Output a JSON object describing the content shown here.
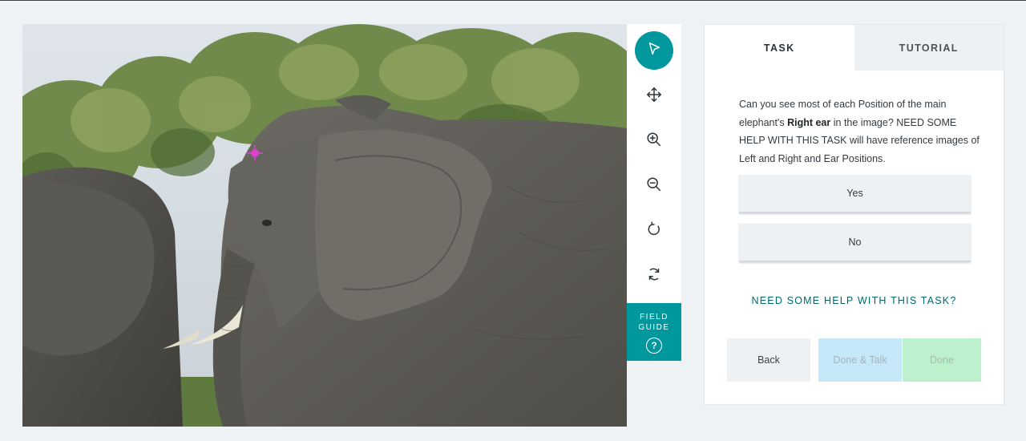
{
  "toolbar": {
    "tools": [
      {
        "icon": "pointer-icon",
        "active": true
      },
      {
        "icon": "move-icon",
        "active": false
      },
      {
        "icon": "zoom-in-icon",
        "active": false
      },
      {
        "icon": "zoom-out-icon",
        "active": false
      },
      {
        "icon": "rotate-icon",
        "active": false
      },
      {
        "icon": "reset-icon",
        "active": false
      }
    ],
    "field_guide": {
      "label": "FIELD GUIDE",
      "help_glyph": "?"
    }
  },
  "subject": {
    "marker_color": "#e040d0",
    "description": ""
  },
  "panel": {
    "tabs": [
      {
        "label": "TASK",
        "active": true
      },
      {
        "label": "TUTORIAL",
        "active": false
      }
    ],
    "question": {
      "before": "Can you see most of each Position of the main elephant's ",
      "emphasis": "Right ear",
      "after": " in the image? NEED SOME HELP WITH THIS TASK will have reference images of Left and Right and Ear Positions."
    },
    "answers": [
      "Yes",
      "No"
    ],
    "help_link": "NEED SOME HELP WITH THIS TASK?",
    "nav": {
      "back": "Back",
      "done_talk": "Done & Talk",
      "done": "Done"
    }
  },
  "colors": {
    "accent": "#00979d",
    "link": "#00686d",
    "done_talk_bg": "#c5e8f8",
    "done_bg": "#bdf0cd"
  }
}
